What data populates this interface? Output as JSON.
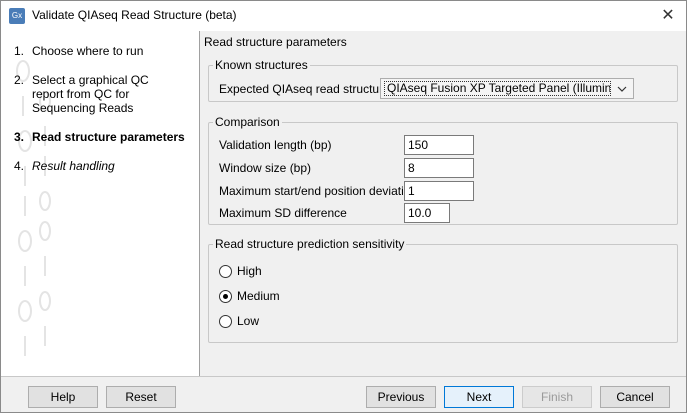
{
  "window": {
    "title": "Validate QIAseq Read Structure (beta)",
    "app_icon": "Gx",
    "close_glyph": "✕"
  },
  "steps": [
    {
      "num": "1.",
      "label": "Choose where to run"
    },
    {
      "num": "2.",
      "label": "Select a graphical QC report from QC for Sequencing Reads"
    },
    {
      "num": "3.",
      "label": "Read structure parameters"
    },
    {
      "num": "4.",
      "label": "Result handling"
    }
  ],
  "content": {
    "section_title": "Read structure parameters",
    "known": {
      "legend": "Known structures",
      "label": "Expected QIAseq read structure",
      "selected": "QIAseq Fusion XP Targeted Panel (Illumina)"
    },
    "comparison": {
      "legend": "Comparison",
      "fields": [
        {
          "label": "Validation length (bp)",
          "value": "150"
        },
        {
          "label": "Window size (bp)",
          "value": "8"
        },
        {
          "label": "Maximum start/end position deviation",
          "value": "1"
        },
        {
          "label": "Maximum SD difference",
          "value": "10.0"
        }
      ]
    },
    "sensitivity": {
      "legend": "Read structure prediction sensitivity",
      "options": [
        {
          "label": "High",
          "checked": false
        },
        {
          "label": "Medium",
          "checked": true
        },
        {
          "label": "Low",
          "checked": false
        }
      ]
    }
  },
  "buttons": {
    "help": "Help",
    "reset": "Reset",
    "previous": "Previous",
    "next": "Next",
    "finish": "Finish",
    "cancel": "Cancel"
  },
  "colors": {
    "accent": "#0078d7",
    "app_icon_bg": "#4a7db8"
  }
}
